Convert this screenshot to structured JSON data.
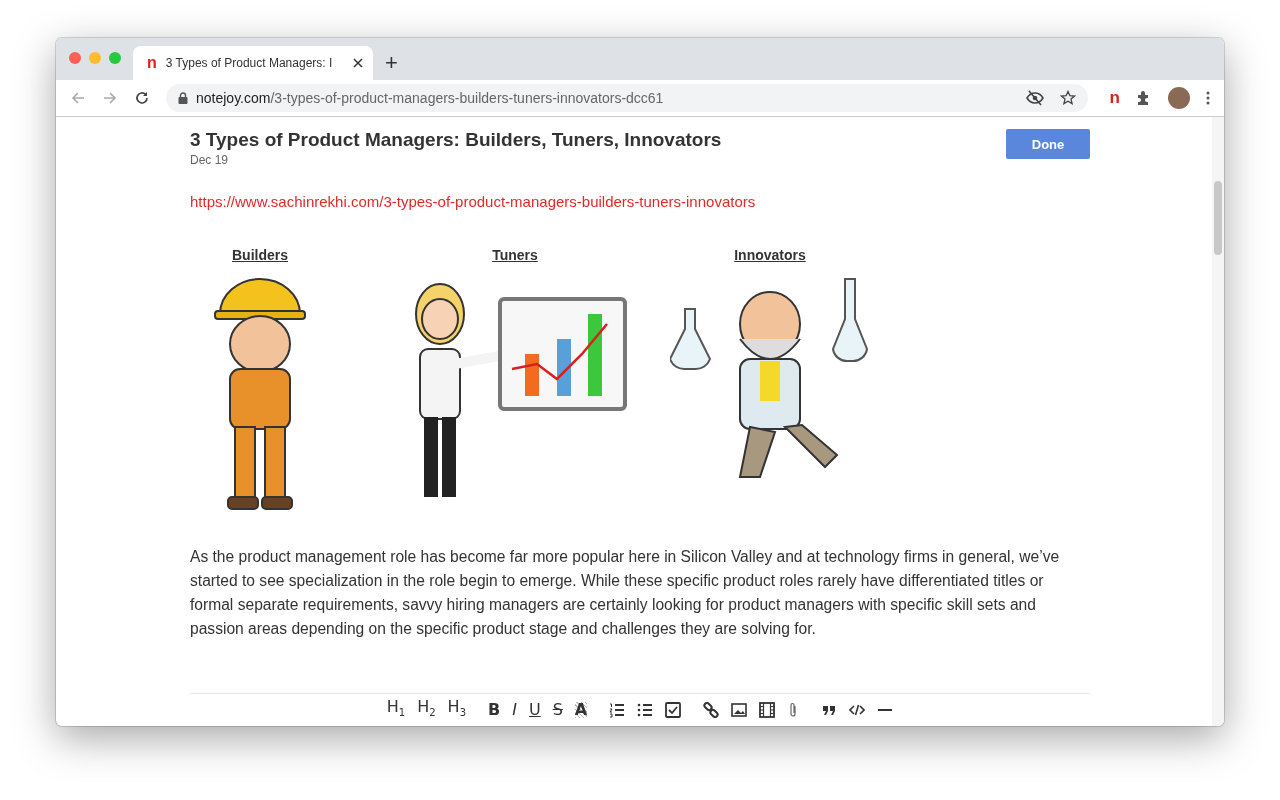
{
  "tab": {
    "title": "3 Types of Product Managers: I",
    "favicon": "n"
  },
  "new_tab": "+",
  "address": {
    "host": "notejoy.com",
    "path": "/3-types-of-product-managers-builders-tuners-innovators-dcc61"
  },
  "extension": "n",
  "note": {
    "title": "3 Types of Product Managers: Builders, Tuners, Innovators",
    "date": "Dec 19",
    "done": "Done",
    "link": "https://www.sachinrekhi.com/3-types-of-product-managers-builders-tuners-innovators",
    "figures": [
      {
        "caption": "Builders",
        "kind": "builder"
      },
      {
        "caption": "Tuners",
        "kind": "tuner"
      },
      {
        "caption": "Innovators",
        "kind": "innovator"
      }
    ],
    "paragraph": "As the product management role has become far more popular here in Silicon Valley and at technology firms in general, we’ve started to see specialization in the role begin to emerge. While these specific product roles rarely have differentiated titles or formal separate requirements, savvy hiring managers are certainly looking for product managers with specific skill sets and passion areas depending on the specific product stage and challenges they are solving for."
  },
  "toolbar": [
    [
      {
        "kind": "heading",
        "text": "H",
        "sub": "1"
      },
      {
        "kind": "heading",
        "text": "H",
        "sub": "2"
      },
      {
        "kind": "heading",
        "text": "H",
        "sub": "3"
      }
    ],
    [
      {
        "kind": "bold",
        "text": "B"
      },
      {
        "kind": "italic",
        "text": "I"
      },
      {
        "kind": "underline",
        "text": "U"
      },
      {
        "kind": "strike",
        "text": "S"
      },
      {
        "kind": "highlight",
        "text": "A"
      }
    ],
    [
      {
        "kind": "ordered-list"
      },
      {
        "kind": "bullet-list"
      },
      {
        "kind": "checkbox"
      }
    ],
    [
      {
        "kind": "link"
      },
      {
        "kind": "image"
      },
      {
        "kind": "video"
      },
      {
        "kind": "attachment"
      }
    ],
    [
      {
        "kind": "quote"
      },
      {
        "kind": "code"
      },
      {
        "kind": "rule"
      }
    ]
  ]
}
